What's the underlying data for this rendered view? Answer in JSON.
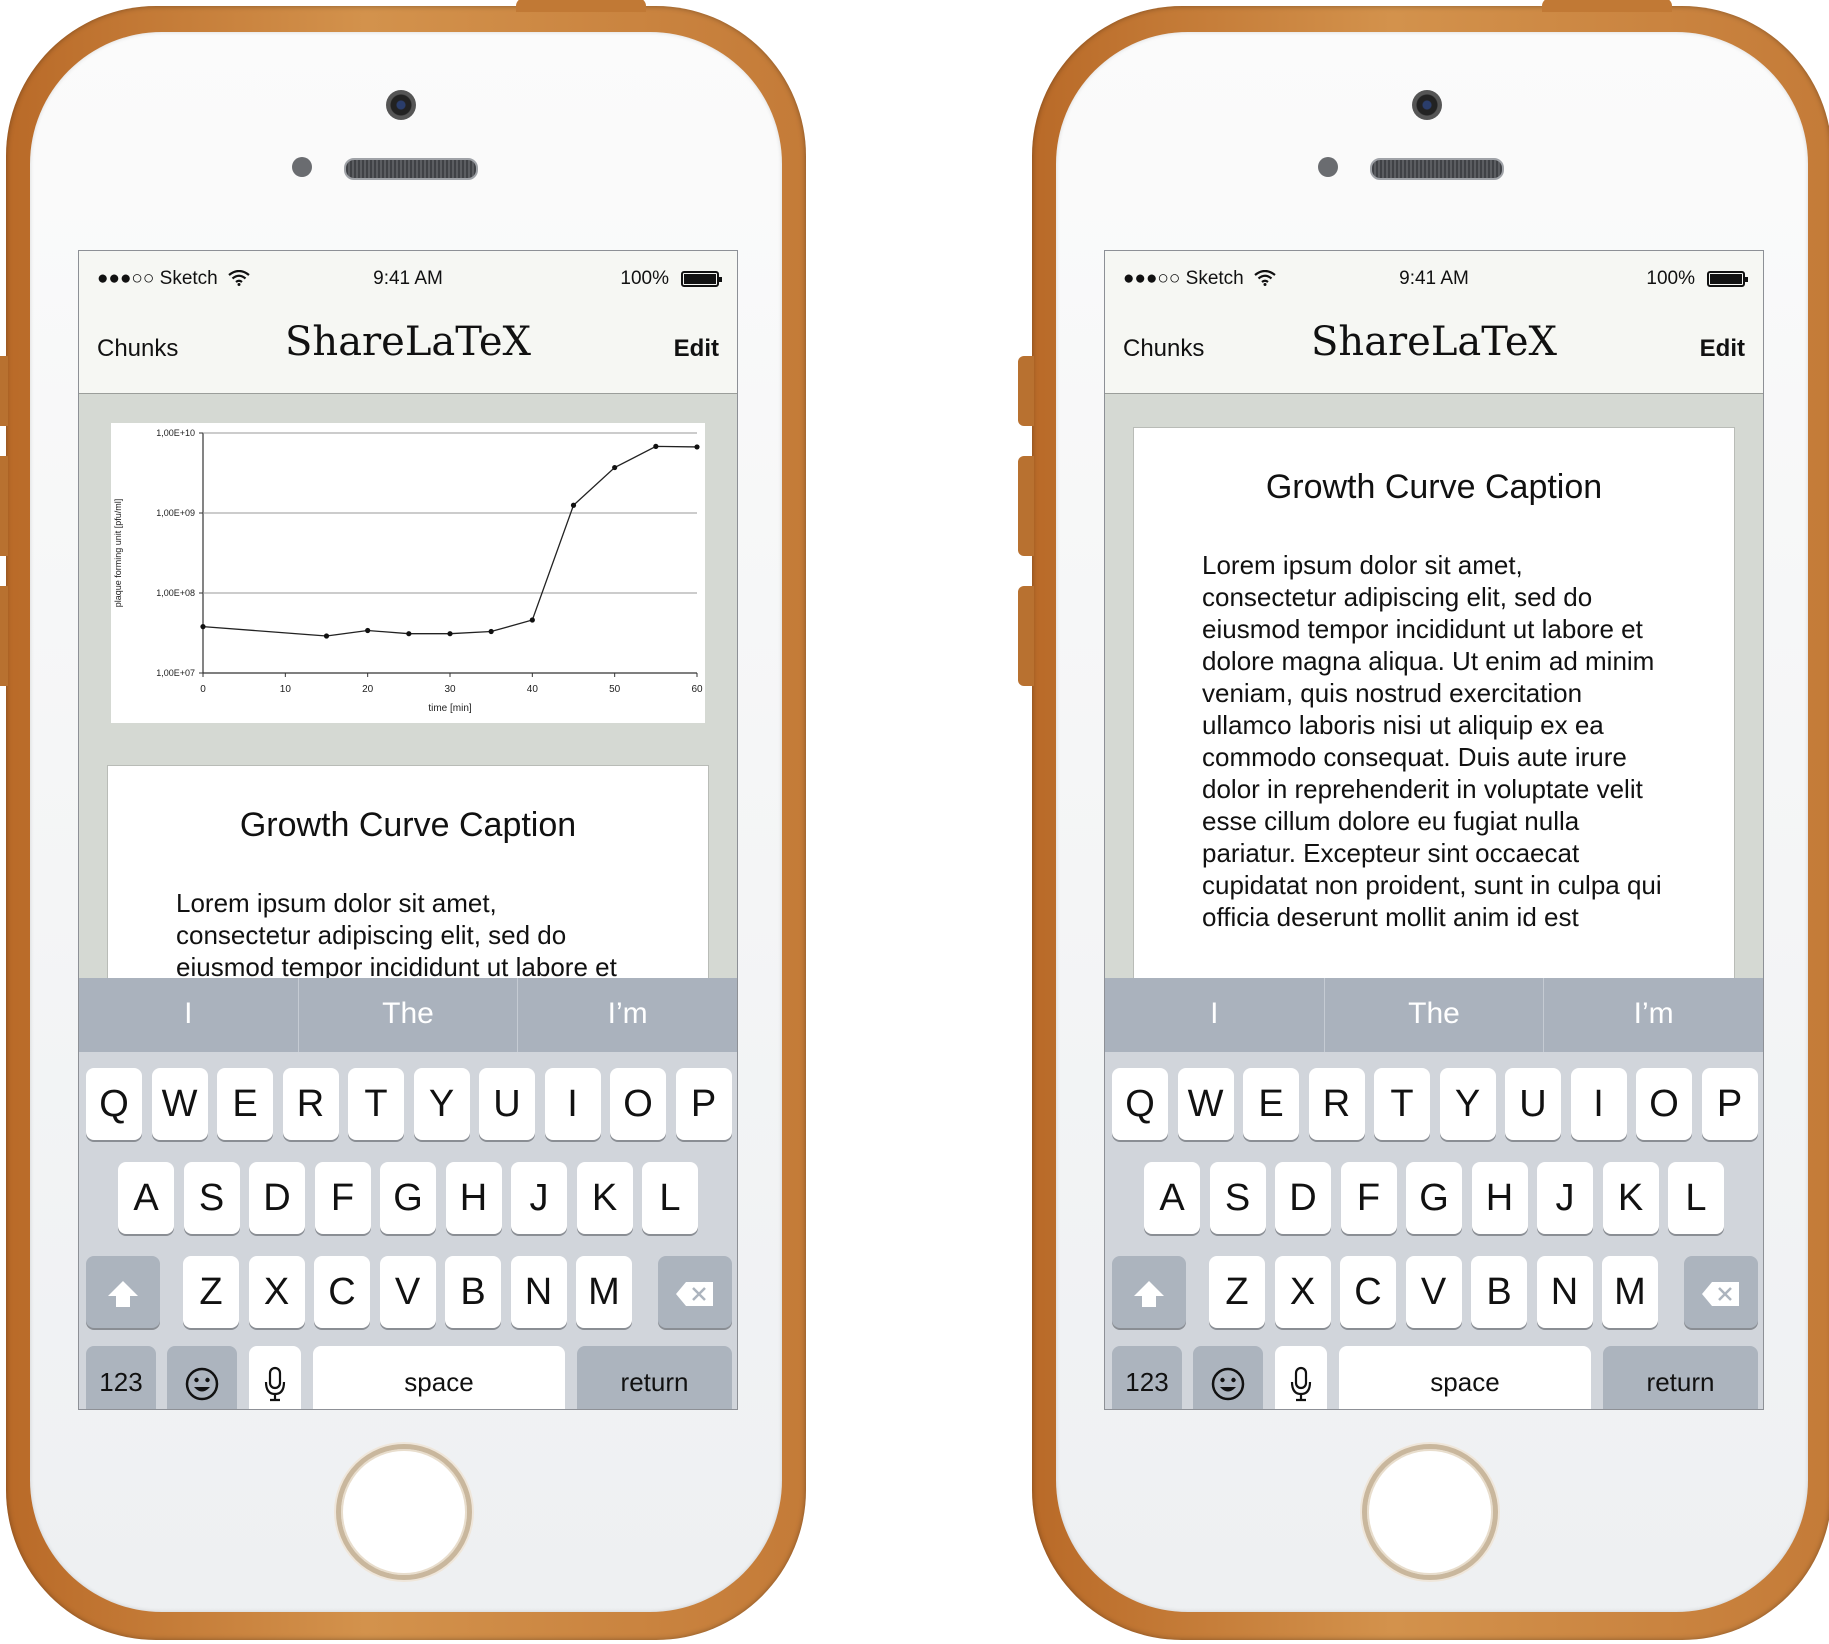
{
  "phones": [
    {
      "status": {
        "carrier": "●●●○○ Sketch",
        "time": "9:41 AM",
        "battery": "100%"
      },
      "nav": {
        "left": "Chunks",
        "title": "ShareLaTeX",
        "right": "Edit"
      },
      "caption": {
        "title": "Growth Curve Caption",
        "text": "Lorem ipsum dolor sit amet, consectetur adipiscing elit, sed do eiusmod tempor incididunt ut labore et dolore magna aliqua. Ut enim ad minim veniam, quis nostrud"
      },
      "suggestions": [
        "I",
        "The",
        "I’m"
      ]
    },
    {
      "status": {
        "carrier": "●●●○○ Sketch",
        "time": "9:41 AM",
        "battery": "100%"
      },
      "nav": {
        "left": "Chunks",
        "title": "ShareLaTeX",
        "right": "Edit"
      },
      "caption": {
        "title": "Growth Curve Caption",
        "text": "Lorem ipsum dolor sit amet, consectetur adipiscing elit, sed do eiusmod tempor incididunt ut labore et dolore magna aliqua. Ut enim ad minim veniam, quis nostrud exercitation ullamco laboris nisi ut aliquip ex ea commodo consequat. Duis aute irure dolor in reprehenderit in voluptate velit esse cillum dolore eu fugiat nulla pariatur. Excepteur sint occaecat cupidatat non proident, sunt in culpa qui officia deserunt mollit anim id est"
      },
      "suggestions": [
        "I",
        "The",
        "I’m"
      ]
    }
  ],
  "keyboard": {
    "row1": [
      "Q",
      "W",
      "E",
      "R",
      "T",
      "Y",
      "U",
      "I",
      "O",
      "P"
    ],
    "row2": [
      "A",
      "S",
      "D",
      "F",
      "G",
      "H",
      "J",
      "K",
      "L"
    ],
    "row3": [
      "Z",
      "X",
      "C",
      "V",
      "B",
      "N",
      "M"
    ],
    "numbers": "123",
    "space": "space",
    "return": "return"
  },
  "chart_data": {
    "type": "line",
    "xlabel": "time [min]",
    "ylabel": "plaque forming unit [pfu/ml]",
    "x_ticks": [
      0,
      10,
      20,
      30,
      40,
      50,
      60
    ],
    "y_ticks": [
      "1,00E+07",
      "1,00E+08",
      "1,00E+09",
      "1,00E+10"
    ],
    "y_scale": "log",
    "ylim": [
      10000000,
      10000000000
    ],
    "xlim": [
      0,
      60
    ],
    "grid": "horizontal",
    "series": [
      {
        "x": [
          0,
          15,
          20,
          25,
          30,
          35,
          40,
          45,
          50,
          55,
          60
        ],
        "y": [
          38000000,
          29000000,
          34000000,
          31000000,
          31000000,
          33000000,
          46000000,
          1250000000,
          3700000000,
          6800000000,
          6700000000
        ]
      }
    ]
  }
}
